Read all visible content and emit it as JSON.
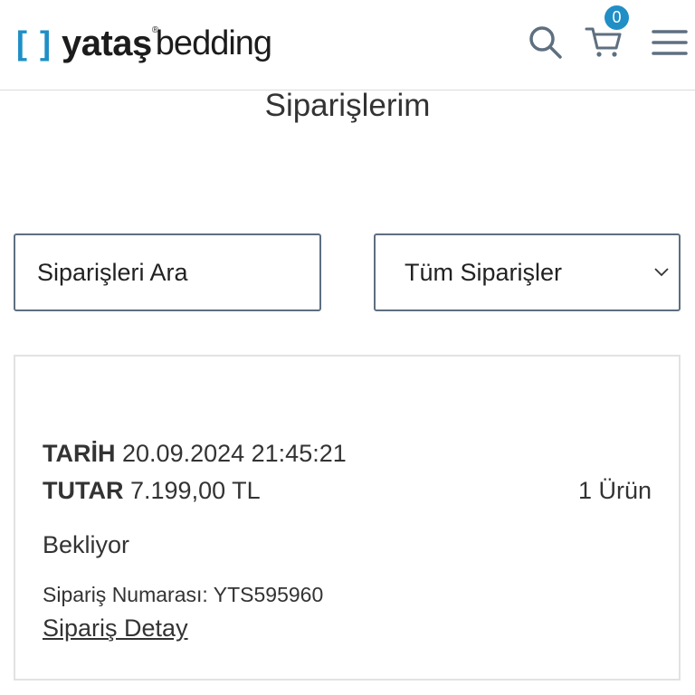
{
  "brand": {
    "bracket": "[ ]",
    "name": "yataş",
    "reg": "®",
    "suffix": "bedding",
    "accent": "#1f8fc6"
  },
  "header": {
    "cart_count": "0",
    "icons": [
      "search-icon",
      "cart-icon",
      "menu-icon"
    ]
  },
  "page": {
    "title": "Siparişlerim"
  },
  "search": {
    "placeholder": "Siparişleri Ara"
  },
  "filter": {
    "selected": "Tüm Siparişler"
  },
  "order": {
    "date_label": "TARİH",
    "date_value": "20.09.2024 21:45:21",
    "total_label": "TUTAR",
    "total_value": "7.199,00 TL",
    "item_count": "1 Ürün",
    "status": "Bekliyor",
    "order_no_text": "Sipariş Numarası: YTS595960",
    "detail_link": "Sipariş Detay"
  }
}
